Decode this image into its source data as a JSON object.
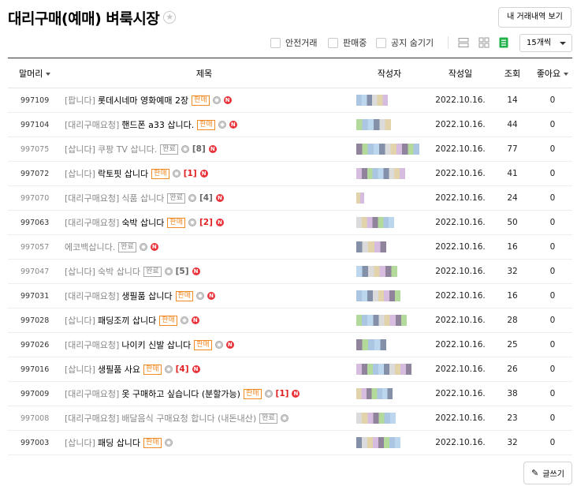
{
  "header": {
    "title": "대리구매(예매) 벼룩시장",
    "history_button": "내 거래내역 보기"
  },
  "filters": {
    "safe_trade": "안전거래",
    "selling": "판매중",
    "hide_notice": "공지 숨기기",
    "per_page": "15개씩"
  },
  "columns": {
    "prefix": "말머리",
    "title": "제목",
    "author": "작성자",
    "date": "작성일",
    "views": "조회",
    "likes": "좋아요"
  },
  "rows": [
    {
      "id": "997109",
      "head": "[팝니다]",
      "text": "롯데시네마 영화예매 2장",
      "badge": "판매",
      "cnt": "",
      "done": false,
      "date": "2022.10.16.",
      "views": "14",
      "likes": "0"
    },
    {
      "id": "997104",
      "head": "[대리구매요청]",
      "text": "핸드폰 a33 삽니다.",
      "badge": "판매",
      "cnt": "",
      "done": false,
      "date": "2022.10.16.",
      "views": "44",
      "likes": "0"
    },
    {
      "id": "997075",
      "head": "[삽니다]",
      "text": "쿠팡 TV 삽니다.",
      "badge": "완료",
      "cnt": "[8]",
      "done": true,
      "date": "2022.10.16.",
      "views": "77",
      "likes": "0"
    },
    {
      "id": "997072",
      "head": "[삽니다]",
      "text": "락토핏 삽니다",
      "badge": "판매",
      "cnt": "[1]",
      "done": false,
      "date": "2022.10.16.",
      "views": "41",
      "likes": "0"
    },
    {
      "id": "997070",
      "head": "[대리구매요청]",
      "text": "식품 삽니다",
      "badge": "완료",
      "cnt": "[4]",
      "done": true,
      "date": "2022.10.16.",
      "views": "24",
      "likes": "0"
    },
    {
      "id": "997063",
      "head": "[대리구매요청]",
      "text": "숙박 삽니다",
      "badge": "판매",
      "cnt": "[2]",
      "done": false,
      "date": "2022.10.16.",
      "views": "50",
      "likes": "0"
    },
    {
      "id": "997057",
      "head": "",
      "text": "에코백삽니다.",
      "badge": "완료",
      "cnt": "",
      "done": true,
      "date": "2022.10.16.",
      "views": "16",
      "likes": "0"
    },
    {
      "id": "997047",
      "head": "[삽니다]",
      "text": "숙박 삽니다",
      "badge": "완료",
      "cnt": "[5]",
      "done": true,
      "date": "2022.10.16.",
      "views": "32",
      "likes": "0"
    },
    {
      "id": "997031",
      "head": "[대리구매요청]",
      "text": "생필품 삽니다",
      "badge": "판매",
      "cnt": "",
      "done": false,
      "date": "2022.10.16.",
      "views": "16",
      "likes": "0"
    },
    {
      "id": "997028",
      "head": "[삽니다]",
      "text": "패딩조끼 삽니다",
      "badge": "판매",
      "cnt": "",
      "done": false,
      "date": "2022.10.16.",
      "views": "28",
      "likes": "0"
    },
    {
      "id": "997026",
      "head": "[대리구매요청]",
      "text": "나이키 신발 삽니다",
      "badge": "판매",
      "cnt": "",
      "done": false,
      "date": "2022.10.16.",
      "views": "25",
      "likes": "0"
    },
    {
      "id": "997016",
      "head": "[삽니다]",
      "text": "생필품 사요",
      "badge": "판매",
      "cnt": "[4]",
      "done": false,
      "date": "2022.10.16.",
      "views": "26",
      "likes": "0"
    },
    {
      "id": "997009",
      "head": "[대리구매요청]",
      "text": "옷 구매하고 싶습니다 (분할가능)",
      "badge": "판매",
      "cnt": "[1]",
      "done": false,
      "date": "2022.10.16.",
      "views": "38",
      "likes": "0"
    },
    {
      "id": "997008",
      "head": "[대리구매요청]",
      "text": "배달음식 구매요청 합니다 (내돈내산)",
      "badge": "완료",
      "cnt": "",
      "done": true,
      "date": "2022.10.16.",
      "views": "23",
      "likes": "0"
    },
    {
      "id": "997003",
      "head": "[삽니다]",
      "text": "패딩 삽니다",
      "badge": "판매",
      "cnt": "",
      "done": false,
      "date": "2022.10.16.",
      "views": "32",
      "likes": "0"
    }
  ],
  "write_button": "글쓰기",
  "colors": {
    "sale_badge": "#f08a24",
    "count_red": "#e02020",
    "new_icon": "#e8333a",
    "active_view": "#1fb24a"
  }
}
